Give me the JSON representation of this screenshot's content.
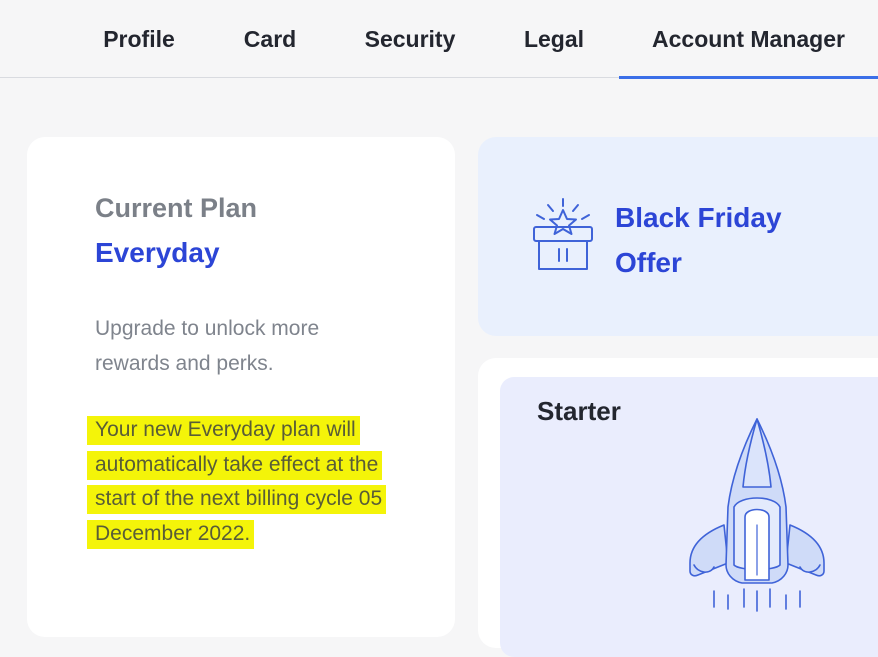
{
  "tabs": [
    {
      "label": "Profile"
    },
    {
      "label": "Card"
    },
    {
      "label": "Security"
    },
    {
      "label": "Legal"
    },
    {
      "label": "Account Manager",
      "active": true
    }
  ],
  "plan": {
    "heading": "Current Plan",
    "name": "Everyday",
    "upgrade_text": "Upgrade to unlock more rewards and perks.",
    "note": "Your new Everyday plan will automatically take effect at the start of the next billing cycle 05 December 2022."
  },
  "offer": {
    "icon": "gift-icon",
    "line1": "Black Friday",
    "line2": "Offer"
  },
  "tier": {
    "title": "Starter",
    "icon": "rocket-icon"
  },
  "colors": {
    "accent": "#2c45d6",
    "tab_underline": "#3b6fe8",
    "highlight": "#f4f409",
    "offer_bg": "#e9f0fd",
    "tier_bg": "#eaedfd"
  }
}
